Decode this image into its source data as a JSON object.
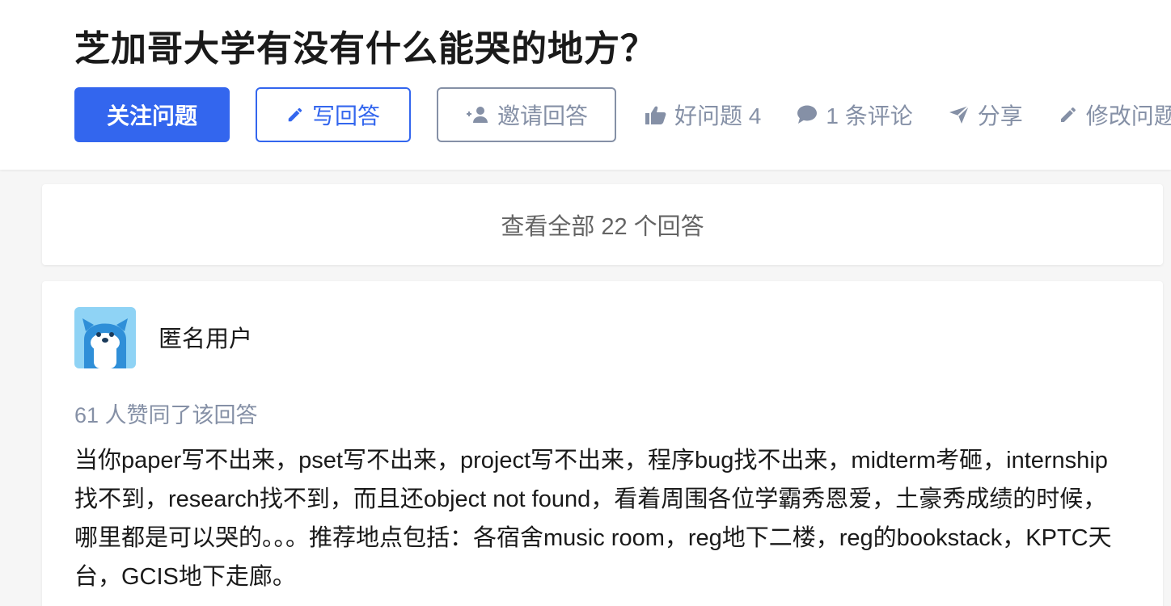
{
  "question": {
    "title": "芝加哥大学有没有什么能哭的地方？"
  },
  "buttons": {
    "follow": "关注问题",
    "write": "写回答",
    "invite": "邀请回答"
  },
  "actions": {
    "good_question": "好问题 4",
    "comments": "1 条评论",
    "share": "分享",
    "edit": "修改问题"
  },
  "view_all": "查看全部 22 个回答",
  "answer": {
    "author": "匿名用户",
    "votes": "61 人赞同了该回答",
    "content": "当你paper写不出来，pset写不出来，project写不出来，程序bug找不出来，midterm考砸，internship找不到，research找不到，而且还object not found，看着周围各位学霸秀恩爱，土豪秀成绩的时候，哪里都是可以哭的。。。推荐地点包括：各宿舍music room，reg地下二楼，reg的bookstack，KPTC天台，GCIS地下走廊。"
  },
  "colors": {
    "primary": "#3366ee",
    "muted": "#8590a6",
    "background": "#f6f6f6"
  },
  "icons": [
    "pencil-icon",
    "add-person-icon",
    "thumbs-up-icon",
    "comment-icon",
    "share-icon",
    "edit-icon",
    "anonymous-avatar"
  ]
}
